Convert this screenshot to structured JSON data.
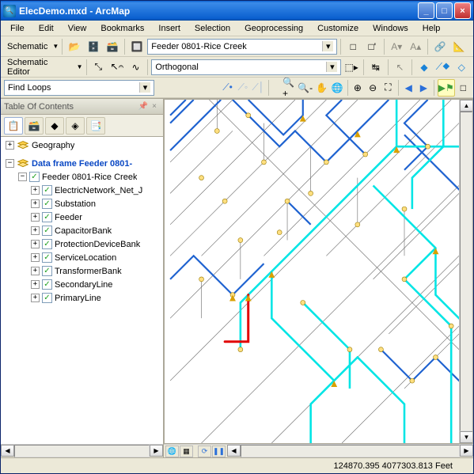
{
  "window": {
    "title": "ElecDemo.mxd - ArcMap"
  },
  "menubar": [
    "File",
    "Edit",
    "View",
    "Bookmarks",
    "Insert",
    "Selection",
    "Geoprocessing",
    "Customize",
    "Windows",
    "Help"
  ],
  "toolbar1": {
    "schematic_label": "Schematic",
    "combo_value": "Feeder 0801-Rice Creek"
  },
  "toolbar2": {
    "editor_label": "Schematic Editor",
    "combo_value": "Orthogonal"
  },
  "toolbar3": {
    "find_value": "Find Loops"
  },
  "toc": {
    "title": "Table Of Contents",
    "nodes": {
      "geography": "Geography",
      "dataframe": "Data frame Feeder 0801-",
      "feeder_root": "Feeder 0801-Rice Creek",
      "layers": [
        "ElectricNetwork_Net_J",
        "Substation",
        "Feeder",
        "CapacitorBank",
        "ProtectionDeviceBank",
        "ServiceLocation",
        "TransformerBank",
        "SecondaryLine",
        "PrimaryLine"
      ]
    }
  },
  "status": {
    "coords": "124870.395 4077303.813 Feet"
  }
}
